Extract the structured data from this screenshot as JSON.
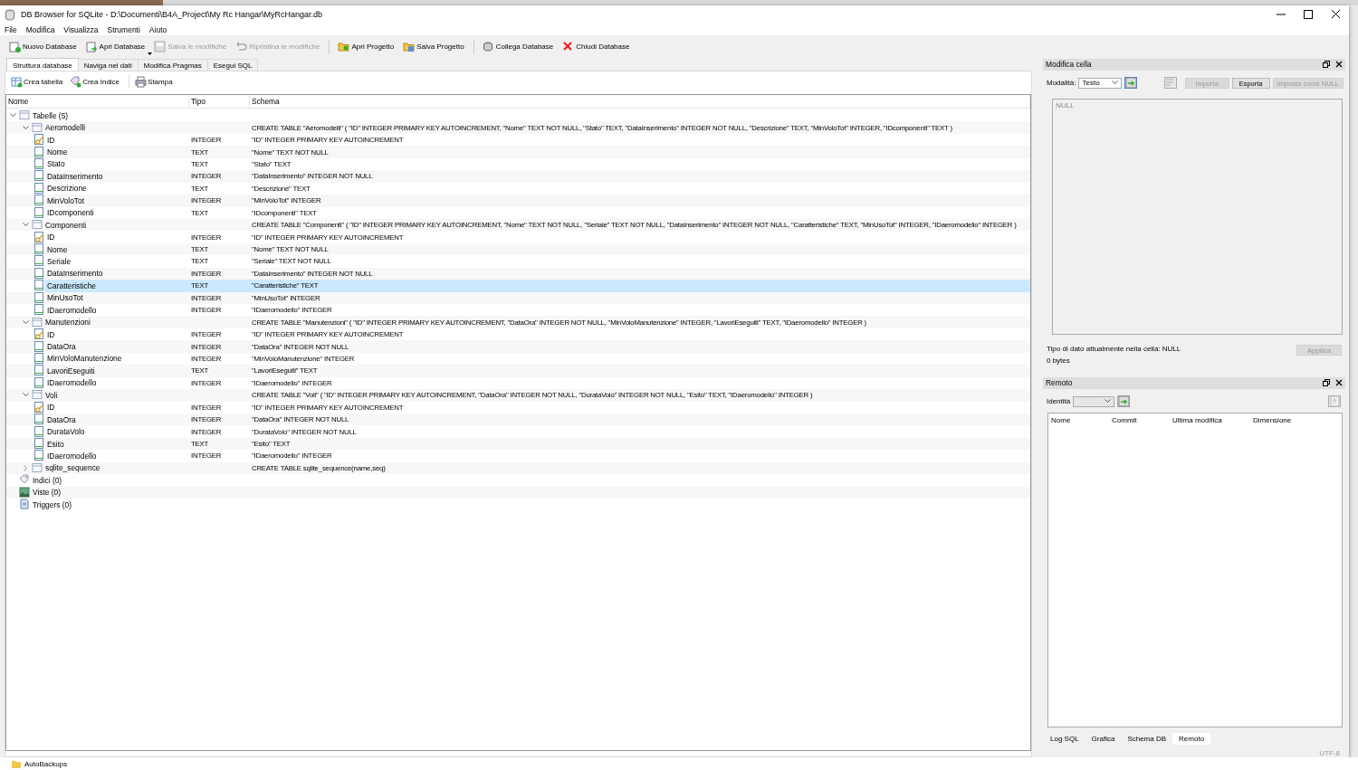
{
  "window": {
    "title": "DB Browser for SQLite - D:\\Documenti\\B4A_Project\\My Rc Hangar\\MyRcHangar.db"
  },
  "menu": [
    "File",
    "Modifica",
    "Visualizza",
    "Strumenti",
    "Aiuto"
  ],
  "toolbar": [
    {
      "kind": "button",
      "label": "Nuovo Database",
      "disabled": false,
      "dropdown": false
    },
    {
      "kind": "button",
      "label": "Apri Database",
      "disabled": false,
      "dropdown": true
    },
    {
      "kind": "button",
      "label": "Salva le modifiche",
      "disabled": true,
      "dropdown": false
    },
    {
      "kind": "button",
      "label": "Ripristina le modifiche",
      "disabled": true,
      "dropdown": false
    },
    {
      "kind": "separator"
    },
    {
      "kind": "button",
      "label": "Apri Progetto",
      "disabled": false,
      "dropdown": false
    },
    {
      "kind": "button",
      "label": "Salva Progetto",
      "disabled": false,
      "dropdown": false
    },
    {
      "kind": "separator"
    },
    {
      "kind": "button",
      "label": "Collega Database",
      "disabled": false,
      "dropdown": false
    },
    {
      "kind": "button",
      "label": "Chiudi Database",
      "disabled": false,
      "dropdown": false
    }
  ],
  "tabs": [
    {
      "label": "Struttura database",
      "selected": true
    },
    {
      "label": "Naviga nei dati",
      "selected": false
    },
    {
      "label": "Modifica Pragmas",
      "selected": false
    },
    {
      "label": "Esegui SQL",
      "selected": false
    }
  ],
  "structure_toolbar": [
    "Crea tabella",
    "Crea Indice",
    "Stampa"
  ],
  "tree": {
    "columns": [
      "Nome",
      "Tipo",
      "Schema"
    ],
    "nodes": [
      {
        "name": "Tabelle (5)",
        "kind": "tables",
        "expanded": true,
        "selected": false,
        "children": [
          {
            "name": "Aeromodelli",
            "kind": "table",
            "schema": "CREATE TABLE \"Aeromodelli\" ( \"ID\" INTEGER PRIMARY KEY AUTOINCREMENT, \"Nome\" TEXT NOT NULL, \"Stato\" TEXT, \"DataInserimento\" INTEGER NOT NULL, \"Descrizione\" TEXT, \"MinVoloTot\" INTEGER, \"IDcomponenti\" TEXT )",
            "expanded": true,
            "selected": false,
            "children": [
              {
                "name": "ID",
                "kind": "key",
                "type": "INTEGER",
                "schema": "\"ID\" INTEGER PRIMARY KEY AUTOINCREMENT",
                "selected": false
              },
              {
                "name": "Nome",
                "kind": "field",
                "type": "TEXT",
                "schema": "\"Nome\" TEXT NOT NULL",
                "selected": false
              },
              {
                "name": "Stato",
                "kind": "field",
                "type": "TEXT",
                "schema": "\"Stato\" TEXT",
                "selected": false
              },
              {
                "name": "DataInserimento",
                "kind": "field",
                "type": "INTEGER",
                "schema": "\"DataInserimento\" INTEGER NOT NULL",
                "selected": false
              },
              {
                "name": "Descrizione",
                "kind": "field",
                "type": "TEXT",
                "schema": "\"Descrizione\" TEXT",
                "selected": false
              },
              {
                "name": "MinVoloTot",
                "kind": "field",
                "type": "INTEGER",
                "schema": "\"MinVoloTot\" INTEGER",
                "selected": false
              },
              {
                "name": "IDcomponenti",
                "kind": "field",
                "type": "TEXT",
                "schema": "\"IDcomponenti\" TEXT",
                "selected": false
              }
            ]
          },
          {
            "name": "Componenti",
            "kind": "table",
            "schema": "CREATE TABLE \"Componenti\" ( \"ID\" INTEGER PRIMARY KEY AUTOINCREMENT, \"Nome\" TEXT NOT NULL, \"Seriale\" TEXT NOT NULL, \"DataInserimento\" INTEGER NOT NULL, \"Caratteristiche\" TEXT, \"MinUsoTot\" INTEGER, \"IDaeromodello\" INTEGER )",
            "expanded": true,
            "selected": false,
            "children": [
              {
                "name": "ID",
                "kind": "key",
                "type": "INTEGER",
                "schema": "\"ID\" INTEGER PRIMARY KEY AUTOINCREMENT",
                "selected": false
              },
              {
                "name": "Nome",
                "kind": "field",
                "type": "TEXT",
                "schema": "\"Nome\" TEXT NOT NULL",
                "selected": false
              },
              {
                "name": "Seriale",
                "kind": "field",
                "type": "TEXT",
                "schema": "\"Seriale\" TEXT NOT NULL",
                "selected": false
              },
              {
                "name": "DataInserimento",
                "kind": "field",
                "type": "INTEGER",
                "schema": "\"DataInserimento\" INTEGER NOT NULL",
                "selected": false
              },
              {
                "name": "Caratteristiche",
                "kind": "field",
                "type": "TEXT",
                "schema": "\"Caratteristiche\" TEXT",
                "selected": true
              },
              {
                "name": "MinUsoTot",
                "kind": "field",
                "type": "INTEGER",
                "schema": "\"MinUsoTot\" INTEGER",
                "selected": false
              },
              {
                "name": "IDaeromodello",
                "kind": "field",
                "type": "INTEGER",
                "schema": "\"IDaeromodello\" INTEGER",
                "selected": false
              }
            ]
          },
          {
            "name": "Manutenzioni",
            "kind": "table",
            "schema": "CREATE TABLE \"Manutenzioni\" ( \"ID\" INTEGER PRIMARY KEY AUTOINCREMENT, \"DataOra\" INTEGER NOT NULL, \"MinVoloManutenzione\" INTEGER, \"LavoriEseguiti\" TEXT, \"IDaeromodello\" INTEGER )",
            "expanded": true,
            "selected": false,
            "children": [
              {
                "name": "ID",
                "kind": "key",
                "type": "INTEGER",
                "schema": "\"ID\" INTEGER PRIMARY KEY AUTOINCREMENT",
                "selected": false
              },
              {
                "name": "DataOra",
                "kind": "field",
                "type": "INTEGER",
                "schema": "\"DataOra\" INTEGER NOT NULL",
                "selected": false
              },
              {
                "name": "MinVoloManutenzione",
                "kind": "field",
                "type": "INTEGER",
                "schema": "\"MinVoloManutenzione\" INTEGER",
                "selected": false
              },
              {
                "name": "LavoriEseguiti",
                "kind": "field",
                "type": "TEXT",
                "schema": "\"LavoriEseguiti\" TEXT",
                "selected": false
              },
              {
                "name": "IDaeromodello",
                "kind": "field",
                "type": "INTEGER",
                "schema": "\"IDaeromodello\" INTEGER",
                "selected": false
              }
            ]
          },
          {
            "name": "Voli",
            "kind": "table",
            "schema": "CREATE TABLE \"Voli\" ( \"ID\" INTEGER PRIMARY KEY AUTOINCREMENT, \"DataOra\" INTEGER NOT NULL, \"DurataVolo\" INTEGER NOT NULL, \"Esito\" TEXT, \"IDaeromodello\" INTEGER )",
            "expanded": true,
            "selected": false,
            "children": [
              {
                "name": "ID",
                "kind": "key",
                "type": "INTEGER",
                "schema": "\"ID\" INTEGER PRIMARY KEY AUTOINCREMENT",
                "selected": false
              },
              {
                "name": "DataOra",
                "kind": "field",
                "type": "INTEGER",
                "schema": "\"DataOra\" INTEGER NOT NULL",
                "selected": false
              },
              {
                "name": "DurataVolo",
                "kind": "field",
                "type": "INTEGER",
                "schema": "\"DurataVolo\" INTEGER NOT NULL",
                "selected": false
              },
              {
                "name": "Esito",
                "kind": "field",
                "type": "TEXT",
                "schema": "\"Esito\" TEXT",
                "selected": false
              },
              {
                "name": "IDaeromodello",
                "kind": "field",
                "type": "INTEGER",
                "schema": "\"IDaeromodello\" INTEGER",
                "selected": false
              }
            ]
          },
          {
            "name": "sqlite_sequence",
            "kind": "table",
            "schema": "CREATE TABLE sqlite_sequence(name,seq)",
            "expanded": false,
            "selected": false
          }
        ]
      },
      {
        "name": "Indici (0)",
        "kind": "indices",
        "selected": false
      },
      {
        "name": "Viste (0)",
        "kind": "views",
        "selected": false
      },
      {
        "name": "Triggers (0)",
        "kind": "triggers",
        "selected": false
      }
    ]
  },
  "edit_cell": {
    "title": "Modifica cella",
    "mode_label": "Modalità:",
    "mode": "Testo",
    "buttons": [
      {
        "label": "Importa",
        "disabled": true
      },
      {
        "label": "Esporta",
        "disabled": false
      },
      {
        "label": "Imposta come NULL",
        "disabled": true
      }
    ],
    "placeholder": "NULL",
    "type_info": "Tipo di dato attualmente nella cella: NULL",
    "size": "0 bytes",
    "apply": {
      "label": "Applica",
      "disabled": true
    }
  },
  "remote": {
    "title": "Remoto",
    "identity_label": "Identità",
    "columns": [
      "Nome",
      "Commit",
      "Ultima modifica",
      "Dimensione"
    ]
  },
  "dock_tabs": [
    {
      "label": "Log SQL",
      "selected": false
    },
    {
      "label": "Grafica",
      "selected": false
    },
    {
      "label": "Schema DB",
      "selected": false
    },
    {
      "label": "Remoto",
      "selected": true
    }
  ],
  "status": {
    "encoding": "UTF-8"
  },
  "desktop": {
    "folder": "AutoBackups"
  }
}
